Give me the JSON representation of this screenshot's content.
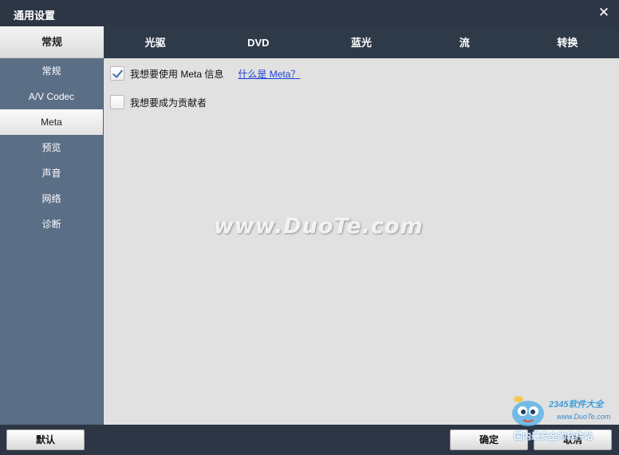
{
  "window": {
    "title": "通用设置",
    "close_glyph": "✕"
  },
  "main_tab": {
    "label": "常规"
  },
  "tabs": [
    {
      "label": "光驱"
    },
    {
      "label": "DVD"
    },
    {
      "label": "蓝光"
    },
    {
      "label": "流"
    },
    {
      "label": "转换"
    }
  ],
  "sidebar": {
    "items": [
      {
        "label": "常规",
        "active": false
      },
      {
        "label": "A/V Codec",
        "active": false
      },
      {
        "label": "Meta",
        "active": true
      },
      {
        "label": "预览",
        "active": false
      },
      {
        "label": "声音",
        "active": false
      },
      {
        "label": "网络",
        "active": false
      },
      {
        "label": "诊断",
        "active": false
      }
    ]
  },
  "content": {
    "use_meta": {
      "label": "我想要使用 Meta 信息",
      "checked": true,
      "link": "什么是 Meta？"
    },
    "contributor": {
      "label": "我想要成为贡献者",
      "checked": false
    }
  },
  "watermark": "www.DuoTe.com",
  "footer": {
    "default_label": "默认",
    "ok_label": "确定",
    "cancel_label": "取消"
  },
  "corner_logo": {
    "brand": "2345软件大全",
    "site": "www.DuoTe.com",
    "slogan": "国内最安全的软件站"
  },
  "colors": {
    "titlebar": "#2c3645",
    "sidebar": "#5a6e86",
    "content": "#e1e1e1",
    "link": "#1c3fd1",
    "check": "#3a6fb5"
  }
}
